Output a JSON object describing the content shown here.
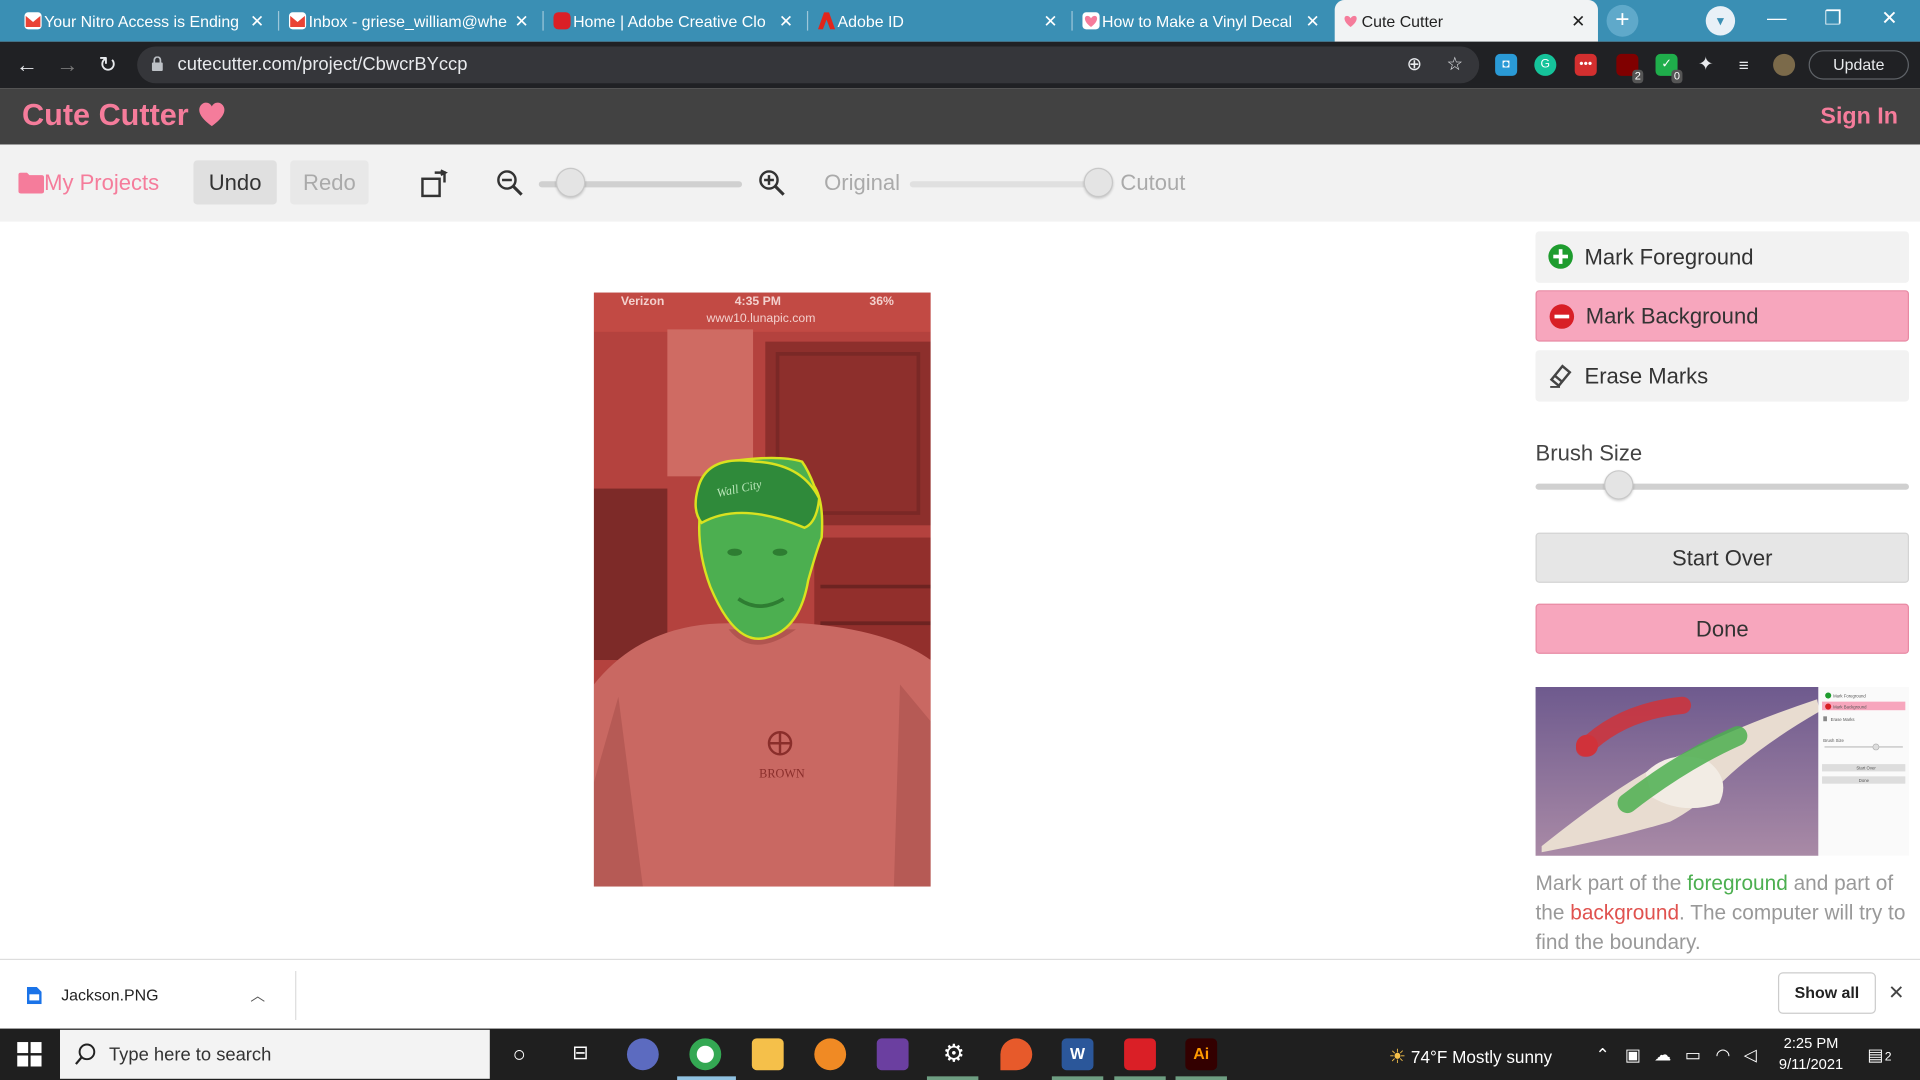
{
  "browser": {
    "tabs": [
      {
        "title": "Your Nitro Access is Ending",
        "icon": "gmail-icon",
        "color": "#ea4335"
      },
      {
        "title": "Inbox - griese_william@whe",
        "icon": "gmail-icon",
        "color": "#ea4335"
      },
      {
        "title": "Home | Adobe Creative Clo",
        "icon": "creative-cloud-icon",
        "color": "#da1f26"
      },
      {
        "title": "Adobe ID",
        "icon": "adobe-icon",
        "color": "#e1251b"
      },
      {
        "title": "How to Make a Vinyl Decal",
        "icon": "cute-cutter-heart-icon",
        "color": "#f57c9b"
      },
      {
        "title": "Cute Cutter",
        "icon": "cute-cutter-heart-icon",
        "color": "#f57c9b"
      }
    ],
    "url": "cutecutter.com/project/CbwcrBYccp",
    "update_label": "Update",
    "extension_badges": {
      "ublock": "2",
      "check": "0"
    }
  },
  "app": {
    "logo": "Cute Cutter",
    "signin": "Sign In",
    "toolbar": {
      "my_projects": "My Projects",
      "undo": "Undo",
      "redo": "Redo",
      "original_label": "Original",
      "cutout_label": "Cutout",
      "zoom_level": 0.1,
      "original_cutout_level": 1.0
    },
    "photo_overlay": {
      "status_carrier": "Verizon",
      "status_time": "4:35 PM",
      "status_battery": "36%",
      "status_url": "www10.lunapic.com",
      "cap_text": "Wall City",
      "shirt_text": "BROWN"
    },
    "panel": {
      "tools": [
        {
          "label": "Mark Foreground",
          "icon": "plus-circle-icon",
          "active": false
        },
        {
          "label": "Mark Background",
          "icon": "minus-circle-icon",
          "active": true
        },
        {
          "label": "Erase Marks",
          "icon": "eraser-icon",
          "active": false
        }
      ],
      "brush_label": "Brush Size",
      "brush_level": 0.2,
      "start_over": "Start Over",
      "done": "Done",
      "demo_menu": [
        "Mark Foreground",
        "Mark Background",
        "Erase Marks",
        "Brush Size",
        "Start Over",
        "Done"
      ],
      "hint_1": "Mark part of the ",
      "hint_fg": "foreground",
      "hint_2": " and part of the ",
      "hint_bg": "background",
      "hint_3": ". The computer will try to find the boundary."
    }
  },
  "downloads": {
    "file": "Jackson.PNG",
    "show_all": "Show all"
  },
  "taskbar": {
    "search_placeholder": "Type here to search",
    "weather": "74°F  Mostly sunny",
    "time": "2:25 PM",
    "date": "9/11/2021",
    "notifications": "2"
  },
  "colors": {
    "brand_pink": "#f57c9b",
    "active_tool": "#f7a6bd",
    "foreground_green": "#4caf50",
    "background_red": "#e0524f"
  }
}
